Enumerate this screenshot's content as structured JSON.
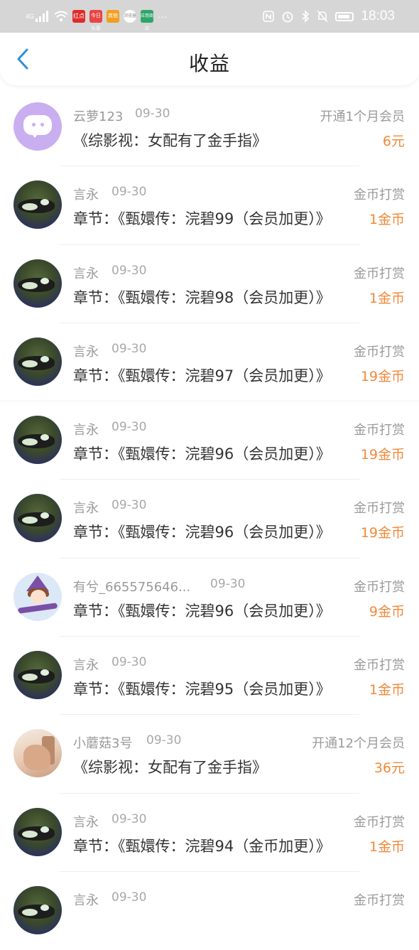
{
  "status_bar": {
    "network": "4G",
    "time": "18:03",
    "app_icons": [
      "红点",
      "今日头条",
      "其他",
      "浏览器",
      "应用商店"
    ],
    "more": "···"
  },
  "header": {
    "title": "收益",
    "back_icon": "chevron-left-icon"
  },
  "colors": {
    "accent": "#f0893a",
    "back_arrow": "#2f8fd9",
    "secondary_text": "#9a9a9a",
    "status_bar_bg": "#d6d6d6"
  },
  "items": [
    {
      "avatar": "chat-bubble",
      "name": "云萝123",
      "date": "09-30",
      "type": "开通1个月会员",
      "content": "《综影视：女配有了金手指》",
      "amount": "6元"
    },
    {
      "avatar": "cat",
      "name": "言永",
      "date": "09-30",
      "type": "金币打赏",
      "content": "章节：《甄嬛传：浣碧99（会员加更）》",
      "amount": "1金币"
    },
    {
      "avatar": "cat",
      "name": "言永",
      "date": "09-30",
      "type": "金币打赏",
      "content": "章节：《甄嬛传：浣碧98（会员加更）》",
      "amount": "1金币"
    },
    {
      "avatar": "cat",
      "name": "言永",
      "date": "09-30",
      "type": "金币打赏",
      "content": "章节：《甄嬛传：浣碧97（会员加更）》",
      "amount": "19金币"
    },
    {
      "avatar": "cat",
      "name": "言永",
      "date": "09-30",
      "type": "金币打赏",
      "content": "章节：《甄嬛传：浣碧96（会员加更）》",
      "amount": "19金币"
    },
    {
      "avatar": "cat",
      "name": "言永",
      "date": "09-30",
      "type": "金币打赏",
      "content": "章节：《甄嬛传：浣碧96（会员加更）》",
      "amount": "19金币"
    },
    {
      "avatar": "witch",
      "name": "有兮_665575646...",
      "date": "09-30",
      "type": "金币打赏",
      "content": "章节：《甄嬛传：浣碧96（会员加更）》",
      "amount": "9金币"
    },
    {
      "avatar": "cat",
      "name": "言永",
      "date": "09-30",
      "type": "金币打赏",
      "content": "章节：《甄嬛传：浣碧95（会员加更）》",
      "amount": "1金币"
    },
    {
      "avatar": "photo",
      "name": "小蘑菇3号",
      "date": "09-30",
      "type": "开通12个月会员",
      "content": "《综影视：女配有了金手指》",
      "amount": "36元"
    },
    {
      "avatar": "cat",
      "name": "言永",
      "date": "09-30",
      "type": "金币打赏",
      "content": "章节：《甄嬛传：浣碧94（金币加更）》",
      "amount": "1金币"
    },
    {
      "avatar": "cat",
      "name": "言永",
      "date": "09-30",
      "type": "金币打赏",
      "content": "",
      "amount": ""
    }
  ]
}
